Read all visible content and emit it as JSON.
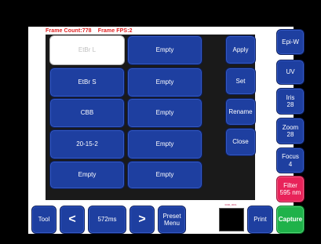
{
  "status": {
    "frame_count": "Frame Count:778",
    "frame_fps": "Frame FPS:2"
  },
  "grid": {
    "row1": {
      "left": "EtBr L",
      "right": "Empty"
    },
    "row2": {
      "left": "EtBr S",
      "right": "Empty"
    },
    "row3": {
      "left": "CBB",
      "right": "Empty"
    },
    "row4": {
      "left": "20-15-2",
      "right": "Empty"
    },
    "row5": {
      "left": "Empty",
      "right": "Empty"
    }
  },
  "preset_actions": {
    "apply": "Apply",
    "set": "Set",
    "rename": "Rename",
    "close": "Close"
  },
  "side": {
    "epi_w": "Epi-W",
    "uv": "UV",
    "iris_label": "Iris",
    "iris_value": "28",
    "zoom_label": "Zoom",
    "zoom_value": "28",
    "focus_label": "Focus",
    "focus_value": "4",
    "filter_label": "Filter",
    "filter_value": "595 nm"
  },
  "toolbar": {
    "tool": "Tool",
    "prev": "<",
    "exposure": "572ms",
    "next": ">",
    "preset_line1": "Preset",
    "preset_line2": "Menu",
    "print": "Print",
    "capture": "Capture"
  },
  "thumbnail": {
    "label": "0000_0001"
  },
  "colors": {
    "button": "#1e3fa0",
    "filter": "#e8235a",
    "capture": "#1fb24a",
    "status": "#e02020"
  }
}
